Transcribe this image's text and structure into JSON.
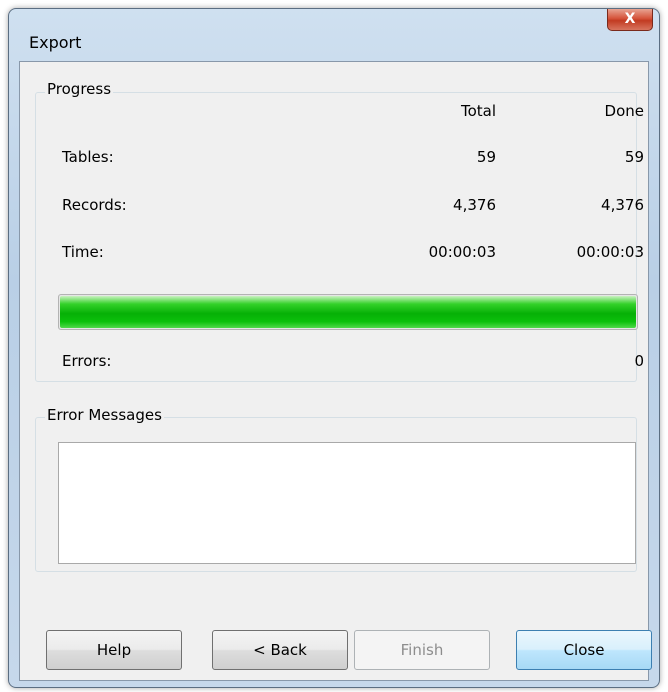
{
  "window": {
    "title": "Export",
    "close_glyph": "X"
  },
  "progress": {
    "group_label": "Progress",
    "header_total": "Total",
    "header_done": "Done",
    "rows": [
      {
        "label": "Tables:",
        "total": "59",
        "done": "59"
      },
      {
        "label": "Records:",
        "total": "4,376",
        "done": "4,376"
      },
      {
        "label": "Time:",
        "total": "00:00:03",
        "done": "00:00:03"
      }
    ],
    "bar_fraction": 1.0,
    "bar_color": "#06b006",
    "errors_label": "Errors:",
    "errors_value": "0"
  },
  "error_messages": {
    "group_label": "Error Messages",
    "text": ""
  },
  "buttons": {
    "help": "Help",
    "back": "< Back",
    "finish": "Finish",
    "close": "Close"
  }
}
